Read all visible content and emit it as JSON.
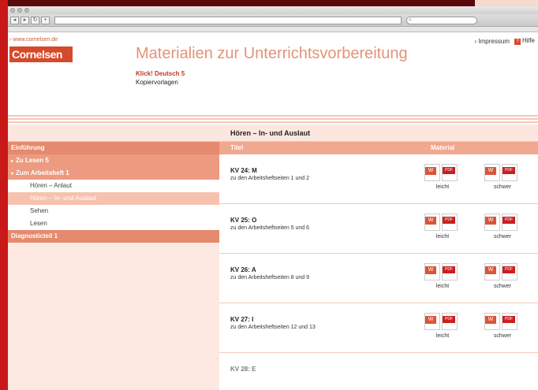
{
  "site_link": "› www.cornelsen.de",
  "logo": "Cornelsen",
  "header": {
    "title": "Materialien zur Unterrichtsvorbereitung",
    "subtitle": "Klick! Deutsch 5",
    "subtitle2": "Kopiervorlagen",
    "impressum": "› Impressum",
    "help": "Hilfe"
  },
  "section_title": "Hören – In- und Auslaut",
  "sidebar": {
    "items": [
      {
        "label": "Einführung"
      },
      {
        "label": "Zu Lesen 5"
      },
      {
        "label": "Zum Arbeitsheft 1"
      },
      {
        "label": "Hören – Anlaut"
      },
      {
        "label": "Hören – In- und Auslaut"
      },
      {
        "label": "Sehen"
      },
      {
        "label": "Lesen"
      },
      {
        "label": "Diagnosticteil 1"
      }
    ]
  },
  "table": {
    "col_title": "Titel",
    "col_material": "Material",
    "rows": [
      {
        "title": "KV 24: M",
        "sub": "zu den Arbeitsheftseiten 1 und 2",
        "easy": "leicht",
        "hard": "schwer"
      },
      {
        "title": "KV 25: O",
        "sub": "zu den Arbeitsheftseiten 5 und 6",
        "easy": "leicht",
        "hard": "schwer"
      },
      {
        "title": "KV 26: A",
        "sub": "zu den Arbeitsheftseiten 8 und 9",
        "easy": "leicht",
        "hard": "schwer"
      },
      {
        "title": "KV 27: I",
        "sub": "zu den Arbeitsheftseiten 12 und 13",
        "easy": "leicht",
        "hard": "schwer"
      },
      {
        "title": "KV 28: E",
        "sub": "",
        "easy": "",
        "hard": ""
      }
    ]
  }
}
